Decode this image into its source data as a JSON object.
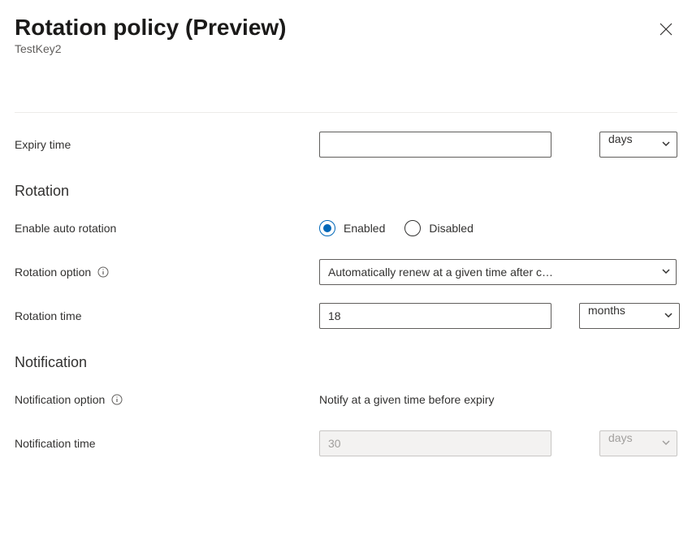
{
  "header": {
    "title": "Rotation policy (Preview)",
    "subtitle": "TestKey2"
  },
  "expiry": {
    "label": "Expiry time",
    "value": "",
    "unit": "days"
  },
  "rotation": {
    "heading": "Rotation",
    "enable_label": "Enable auto rotation",
    "enabled_label": "Enabled",
    "disabled_label": "Disabled",
    "selected": "enabled",
    "option_label": "Rotation option",
    "option_value": "Automatically renew at a given time after c…",
    "time_label": "Rotation time",
    "time_value": "18",
    "time_unit": "months"
  },
  "notification": {
    "heading": "Notification",
    "option_label": "Notification option",
    "option_value": "Notify at a given time before expiry",
    "time_label": "Notification time",
    "time_value": "30",
    "time_unit": "days"
  }
}
